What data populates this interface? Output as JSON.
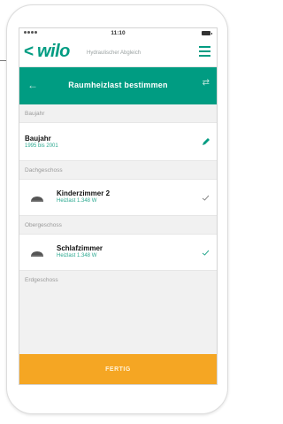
{
  "status_bar": {
    "time": "11:10"
  },
  "header": {
    "back_glyph": "<",
    "logo": "wilo",
    "subtitle": "Hydraulischer Abgleich",
    "menu_icon": "hamburger-icon"
  },
  "title_bar": {
    "back_glyph": "←",
    "title": "Raumheizlast bestimmen",
    "swap_glyph": "⇄"
  },
  "sections": {
    "baujahr": {
      "header": "Baujahr",
      "row": {
        "title": "Baujahr",
        "subtitle": "1995 bis 2001",
        "icon": "pencil-icon"
      }
    },
    "dachgeschoss": {
      "header": "Dachgeschoss",
      "row": {
        "title": "Kinderzimmer 2",
        "subtitle": "Heizlast 1.348 W",
        "icon": "check-icon"
      }
    },
    "obergeschoss": {
      "header": "Obergeschoss",
      "row": {
        "title": "Schlafzimmer",
        "subtitle": "Heizlast 1.348 W",
        "icon": "check-icon"
      }
    },
    "erdgeschoss": {
      "header": "Erdgeschoss"
    }
  },
  "footer": {
    "done_label": "FERTIG"
  },
  "colors": {
    "brand": "#009c82",
    "accent_orange": "#f5a623",
    "subtitle_green": "#2aa88f",
    "background": "#f1f1f1"
  }
}
